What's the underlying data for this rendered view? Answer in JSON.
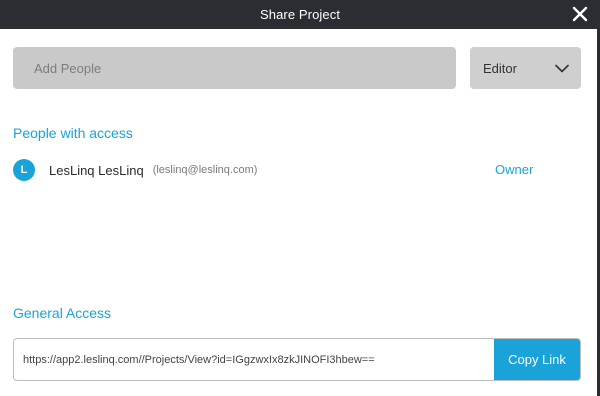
{
  "dialog": {
    "title": "Share Project",
    "close_icon": "close-icon"
  },
  "add_people": {
    "placeholder": "Add People"
  },
  "role_select": {
    "selected": "Editor",
    "icon": "chevron-down-icon"
  },
  "people_section": {
    "heading": "People with access",
    "people": [
      {
        "initial": "L",
        "name": "LesLinq LesLinq",
        "email": "(leslinq@leslinq.com)",
        "role": "Owner"
      }
    ]
  },
  "general_access": {
    "heading": "General Access",
    "link": "https://app2.leslinq.com//Projects/View?id=IGgzwxIx8zkJINOFI3hbew==",
    "copy_label": "Copy Link"
  },
  "colors": {
    "accent": "#1aa3d8",
    "titlebar": "#2a2d31",
    "input_bg": "#c9c9c9"
  }
}
